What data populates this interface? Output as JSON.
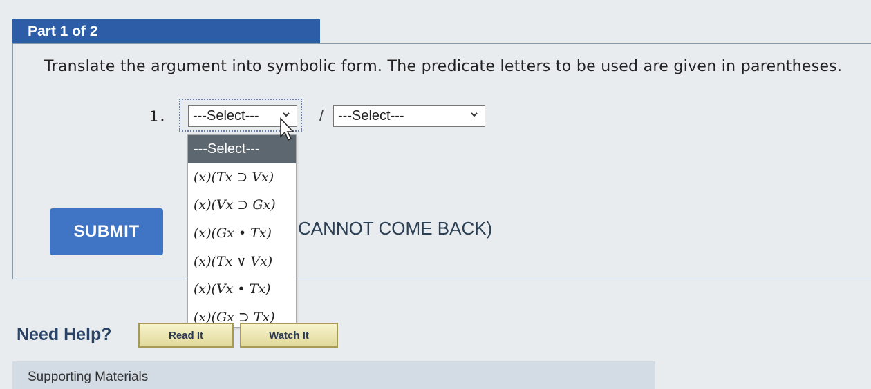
{
  "part": {
    "title": "Part 1 of 2"
  },
  "instruction": "Translate the argument into symbolic form. The predicate letters to be used are given in parentheses.",
  "question": {
    "number": "1.",
    "separator": "/",
    "select_1": {
      "value": "---Select---"
    },
    "select_2": {
      "value": "---Select---"
    }
  },
  "dropdown": {
    "items": [
      "---Select---",
      "(x)(Tx ⊃ Vx)",
      "(x)(Vx ⊃ Gx)",
      "(x)(Gx • Tx)",
      "(x)(Tx ∨ Vx)",
      "(x)(Vx • Tx)",
      "(x)(Gx ⊃ Tx)"
    ],
    "selected_index": 0
  },
  "submit": {
    "label": "SUBMIT"
  },
  "warning_text": "CANNOT COME BACK)",
  "help": {
    "label": "Need Help?",
    "read_label": "Read It",
    "watch_label": "Watch It"
  },
  "supporting": {
    "label": "Supporting Materials"
  },
  "colors": {
    "header_blue": "#2e5da8",
    "submit_blue": "#3f75c4",
    "selected_gray": "#5d6770"
  }
}
